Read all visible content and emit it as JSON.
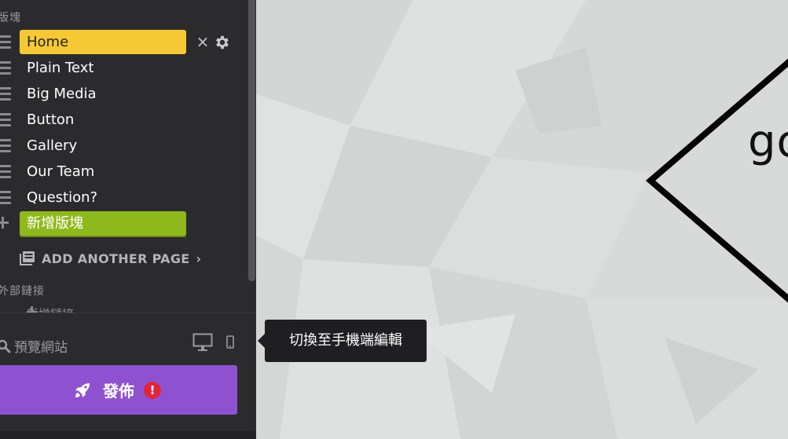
{
  "sidebar": {
    "section_blocks": "版塊",
    "blocks": [
      {
        "label": "Home"
      },
      {
        "label": "Plain Text"
      },
      {
        "label": "Big Media"
      },
      {
        "label": "Button"
      },
      {
        "label": "Gallery"
      },
      {
        "label": "Our Team"
      },
      {
        "label": "Question?"
      }
    ],
    "add_block_label": "新增版塊",
    "add_page_label": "ADD ANOTHER PAGE",
    "section_links": "外部鏈接",
    "add_link_label": "新增鏈接",
    "close_glyph": "×",
    "chevron_glyph": "›"
  },
  "bottom": {
    "preview_label": "預覽網站",
    "publish_label": "發佈",
    "warning_glyph": "!"
  },
  "tooltip": {
    "text": "切換至手機端編輯"
  },
  "canvas": {
    "logo_text": "go"
  },
  "colors": {
    "active_block": "#f5c934",
    "add_block": "#8fb81c",
    "publish": "#8e52d1",
    "warning": "#e4243d",
    "sidebar_bg": "#2b2b2d"
  },
  "icons": [
    "drag-handle-icon",
    "close-icon",
    "gear-icon",
    "plus-icon",
    "pages-icon",
    "chevron-right-icon",
    "search-icon",
    "desktop-icon",
    "mobile-icon",
    "rocket-icon",
    "warning-icon"
  ]
}
